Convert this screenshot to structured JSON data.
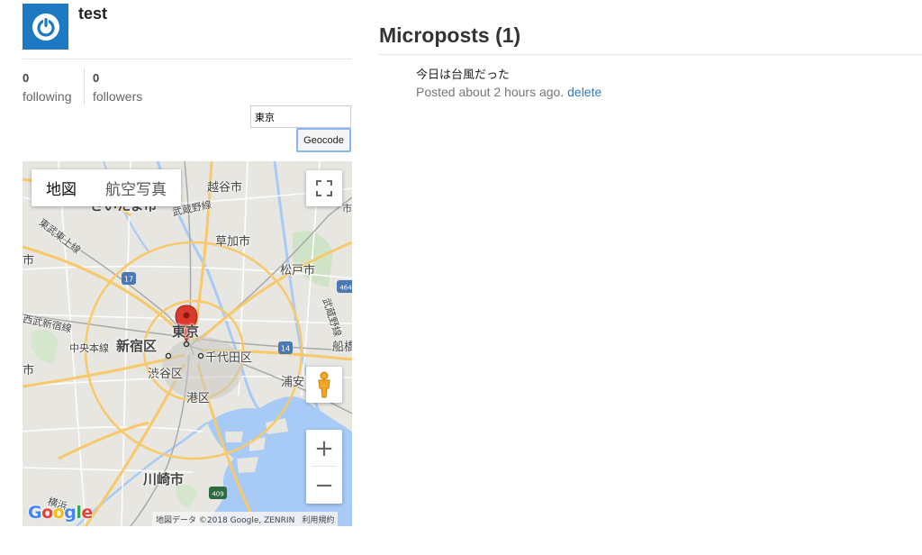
{
  "user": {
    "name": "test",
    "avatar": "power-icon"
  },
  "stats": {
    "following": {
      "count": "0",
      "label": "following"
    },
    "followers": {
      "count": "0",
      "label": "followers"
    }
  },
  "geocode": {
    "value": "東京",
    "button_label": "Geocode"
  },
  "map": {
    "type_options": [
      "地図",
      "航空写真"
    ],
    "selected_type": "地図",
    "labels": {
      "koshigaya": "越谷市",
      "saitama": "さいたま市",
      "musashino_line": "武蔵野線",
      "tobu_tojo": "東武東上線",
      "soka": "草加市",
      "matsudo": "松戸市",
      "musashino_line2": "武蔵野線",
      "seibu_shinjuku": "西武新宿線",
      "tokyo": "東京",
      "chuo_line": "中央本線",
      "shinjuku": "新宿区",
      "chiyoda": "千代田区",
      "funabashi": "船橋",
      "ichi": "市",
      "shibuya": "渋谷区",
      "urayasu": "浦安",
      "minato": "港区",
      "kawasaki": "川崎市",
      "yokohama": "横浜",
      "edge_shi": "市",
      "edge_shi2": "市"
    },
    "shields": {
      "r17": "17",
      "r14": "14",
      "r464": "464",
      "r409": "409"
    },
    "logo": "Google",
    "attribution": "地図データ ©2018 Google, ZENRIN",
    "terms": "利用規約",
    "zoom_in": "+",
    "zoom_out": "−",
    "colors": {
      "water": "#a7cbf6",
      "land": "#e8e6e1",
      "highway": "#f7c96a",
      "rail": "#a9a9a9",
      "pin": "#d93a2b"
    }
  },
  "microposts": {
    "title": "Microposts (1)",
    "items": [
      {
        "content": "今日は台風だった",
        "timestamp": "Posted about 2 hours ago.",
        "delete_label": "delete"
      }
    ]
  }
}
